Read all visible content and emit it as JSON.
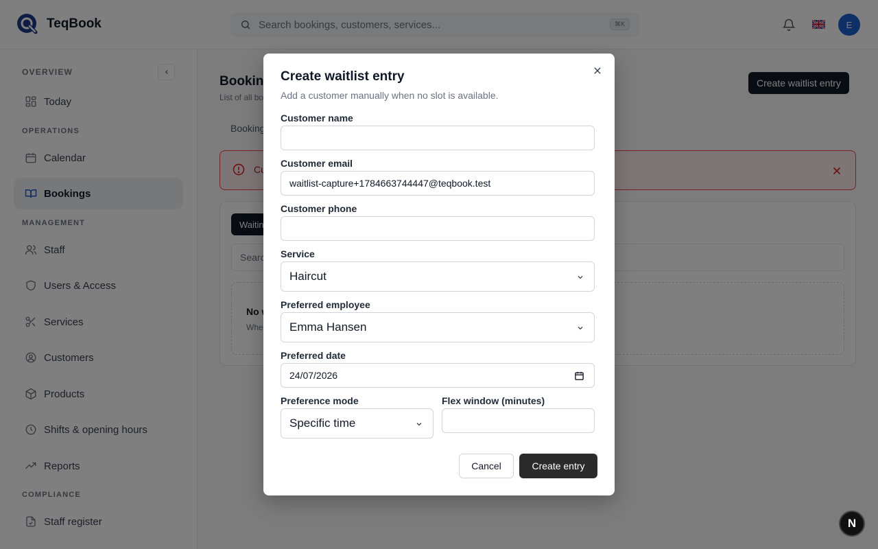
{
  "app": {
    "name": "TeqBook"
  },
  "header": {
    "search_placeholder": "Search bookings, customers, services...",
    "shortcut": "⌘K",
    "avatar_initial": "E"
  },
  "sidebar": {
    "sections": {
      "overview": "OVERVIEW",
      "operations": "OPERATIONS",
      "management": "MANAGEMENT",
      "compliance": "COMPLIANCE"
    },
    "items": {
      "today": "Today",
      "calendar": "Calendar",
      "bookings": "Bookings",
      "staff": "Staff",
      "users_access": "Users & Access",
      "services": "Services",
      "customers": "Customers",
      "products": "Products",
      "shifts": "Shifts & opening hours",
      "reports": "Reports",
      "staff_register": "Staff register"
    },
    "active": "bookings"
  },
  "main": {
    "title_fragment": "Booking",
    "subtitle_fragment": "List of all bo",
    "cta_label": "Create waitlist entry",
    "tab_fragment": "Booking",
    "alert_fragment": "Cu",
    "chip_fragment": "Waitin",
    "search_fragment": "Searc",
    "empty_title_fragment": "No w",
    "empty_sub_fragment": "Whe"
  },
  "modal": {
    "title": "Create waitlist entry",
    "description": "Add a customer manually when no slot is available.",
    "customer_name_label": "Customer name",
    "customer_name_value": "",
    "customer_email_label": "Customer email",
    "customer_email_value": "waitlist-capture+1784663744447@teqbook.test",
    "customer_phone_label": "Customer phone",
    "customer_phone_value": "",
    "service_label": "Service",
    "service_value": "Haircut",
    "employee_label": "Preferred employee",
    "employee_value": "Emma Hansen",
    "date_label": "Preferred date",
    "date_value": "24/07/2026",
    "mode_label": "Preference mode",
    "mode_value": "Specific time",
    "flex_label": "Flex window (minutes)",
    "flex_value": "",
    "cancel_label": "Cancel",
    "submit_label": "Create entry"
  },
  "dev_badge": "N",
  "colors": {
    "primary_dark": "#111827",
    "avatar_blue": "#1f5fcf",
    "alert_red": "#ef4444"
  }
}
